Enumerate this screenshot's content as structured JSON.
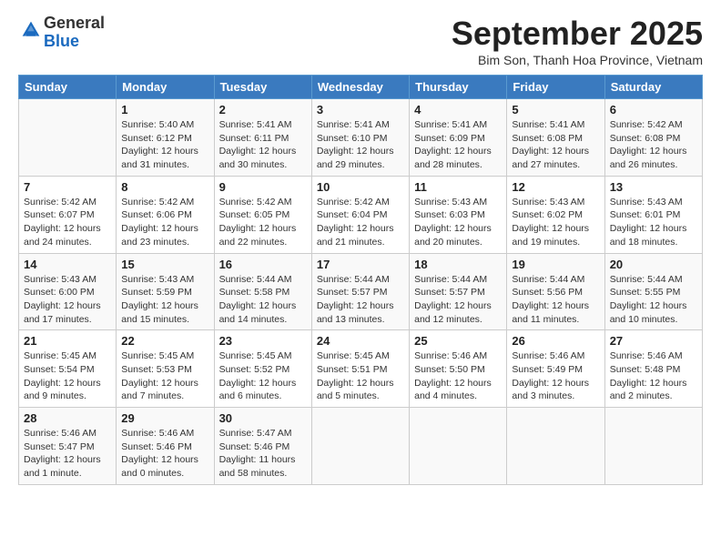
{
  "header": {
    "logo_line1": "General",
    "logo_line2": "Blue",
    "month": "September 2025",
    "location": "Bim Son, Thanh Hoa Province, Vietnam"
  },
  "weekdays": [
    "Sunday",
    "Monday",
    "Tuesday",
    "Wednesday",
    "Thursday",
    "Friday",
    "Saturday"
  ],
  "weeks": [
    [
      {
        "day": "",
        "info": ""
      },
      {
        "day": "1",
        "info": "Sunrise: 5:40 AM\nSunset: 6:12 PM\nDaylight: 12 hours\nand 31 minutes."
      },
      {
        "day": "2",
        "info": "Sunrise: 5:41 AM\nSunset: 6:11 PM\nDaylight: 12 hours\nand 30 minutes."
      },
      {
        "day": "3",
        "info": "Sunrise: 5:41 AM\nSunset: 6:10 PM\nDaylight: 12 hours\nand 29 minutes."
      },
      {
        "day": "4",
        "info": "Sunrise: 5:41 AM\nSunset: 6:09 PM\nDaylight: 12 hours\nand 28 minutes."
      },
      {
        "day": "5",
        "info": "Sunrise: 5:41 AM\nSunset: 6:08 PM\nDaylight: 12 hours\nand 27 minutes."
      },
      {
        "day": "6",
        "info": "Sunrise: 5:42 AM\nSunset: 6:08 PM\nDaylight: 12 hours\nand 26 minutes."
      }
    ],
    [
      {
        "day": "7",
        "info": "Sunrise: 5:42 AM\nSunset: 6:07 PM\nDaylight: 12 hours\nand 24 minutes."
      },
      {
        "day": "8",
        "info": "Sunrise: 5:42 AM\nSunset: 6:06 PM\nDaylight: 12 hours\nand 23 minutes."
      },
      {
        "day": "9",
        "info": "Sunrise: 5:42 AM\nSunset: 6:05 PM\nDaylight: 12 hours\nand 22 minutes."
      },
      {
        "day": "10",
        "info": "Sunrise: 5:42 AM\nSunset: 6:04 PM\nDaylight: 12 hours\nand 21 minutes."
      },
      {
        "day": "11",
        "info": "Sunrise: 5:43 AM\nSunset: 6:03 PM\nDaylight: 12 hours\nand 20 minutes."
      },
      {
        "day": "12",
        "info": "Sunrise: 5:43 AM\nSunset: 6:02 PM\nDaylight: 12 hours\nand 19 minutes."
      },
      {
        "day": "13",
        "info": "Sunrise: 5:43 AM\nSunset: 6:01 PM\nDaylight: 12 hours\nand 18 minutes."
      }
    ],
    [
      {
        "day": "14",
        "info": "Sunrise: 5:43 AM\nSunset: 6:00 PM\nDaylight: 12 hours\nand 17 minutes."
      },
      {
        "day": "15",
        "info": "Sunrise: 5:43 AM\nSunset: 5:59 PM\nDaylight: 12 hours\nand 15 minutes."
      },
      {
        "day": "16",
        "info": "Sunrise: 5:44 AM\nSunset: 5:58 PM\nDaylight: 12 hours\nand 14 minutes."
      },
      {
        "day": "17",
        "info": "Sunrise: 5:44 AM\nSunset: 5:57 PM\nDaylight: 12 hours\nand 13 minutes."
      },
      {
        "day": "18",
        "info": "Sunrise: 5:44 AM\nSunset: 5:57 PM\nDaylight: 12 hours\nand 12 minutes."
      },
      {
        "day": "19",
        "info": "Sunrise: 5:44 AM\nSunset: 5:56 PM\nDaylight: 12 hours\nand 11 minutes."
      },
      {
        "day": "20",
        "info": "Sunrise: 5:44 AM\nSunset: 5:55 PM\nDaylight: 12 hours\nand 10 minutes."
      }
    ],
    [
      {
        "day": "21",
        "info": "Sunrise: 5:45 AM\nSunset: 5:54 PM\nDaylight: 12 hours\nand 9 minutes."
      },
      {
        "day": "22",
        "info": "Sunrise: 5:45 AM\nSunset: 5:53 PM\nDaylight: 12 hours\nand 7 minutes."
      },
      {
        "day": "23",
        "info": "Sunrise: 5:45 AM\nSunset: 5:52 PM\nDaylight: 12 hours\nand 6 minutes."
      },
      {
        "day": "24",
        "info": "Sunrise: 5:45 AM\nSunset: 5:51 PM\nDaylight: 12 hours\nand 5 minutes."
      },
      {
        "day": "25",
        "info": "Sunrise: 5:46 AM\nSunset: 5:50 PM\nDaylight: 12 hours\nand 4 minutes."
      },
      {
        "day": "26",
        "info": "Sunrise: 5:46 AM\nSunset: 5:49 PM\nDaylight: 12 hours\nand 3 minutes."
      },
      {
        "day": "27",
        "info": "Sunrise: 5:46 AM\nSunset: 5:48 PM\nDaylight: 12 hours\nand 2 minutes."
      }
    ],
    [
      {
        "day": "28",
        "info": "Sunrise: 5:46 AM\nSunset: 5:47 PM\nDaylight: 12 hours\nand 1 minute."
      },
      {
        "day": "29",
        "info": "Sunrise: 5:46 AM\nSunset: 5:46 PM\nDaylight: 12 hours\nand 0 minutes."
      },
      {
        "day": "30",
        "info": "Sunrise: 5:47 AM\nSunset: 5:46 PM\nDaylight: 11 hours\nand 58 minutes."
      },
      {
        "day": "",
        "info": ""
      },
      {
        "day": "",
        "info": ""
      },
      {
        "day": "",
        "info": ""
      },
      {
        "day": "",
        "info": ""
      }
    ]
  ]
}
